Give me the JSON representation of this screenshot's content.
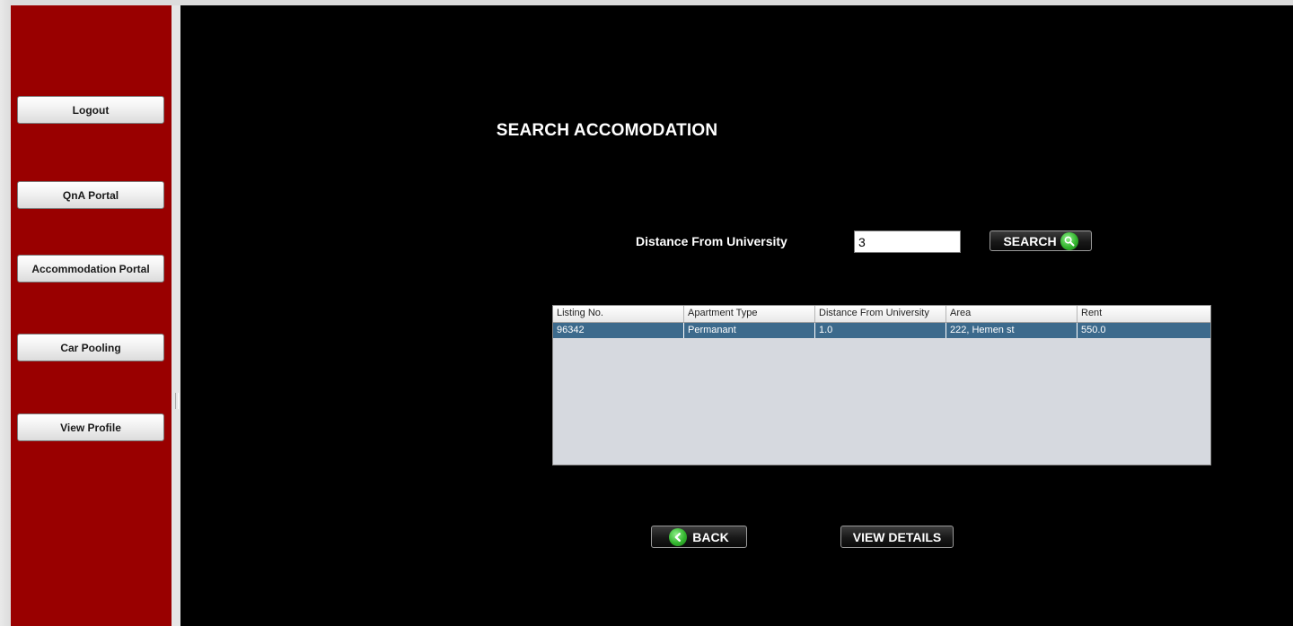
{
  "sidebar": {
    "items": [
      {
        "label": "Logout"
      },
      {
        "label": "QnA Portal"
      },
      {
        "label": "Accommodation Portal"
      },
      {
        "label": "Car Pooling"
      },
      {
        "label": "View Profile"
      }
    ]
  },
  "main": {
    "title": "SEARCH ACCOMODATION",
    "distance_label": "Distance From University",
    "distance_value": "3",
    "search_label": "SEARCH",
    "back_label": "BACK",
    "view_details_label": "VIEW DETAILS",
    "table": {
      "columns": [
        "Listing No.",
        "Apartment Type",
        "Distance From University",
        "Area",
        "Rent"
      ],
      "rows": [
        [
          "96342",
          "Permanant",
          "1.0",
          "222, Hemen st",
          "550.0"
        ]
      ],
      "selected_row": 0
    }
  },
  "icons": {
    "search": "magnifier-icon",
    "back": "arrow-left-icon"
  },
  "colors": {
    "sidebar_bg": "#990000",
    "main_bg": "#000000",
    "selected_row": "#3c6a8c",
    "icon_green": "#33b52e"
  }
}
